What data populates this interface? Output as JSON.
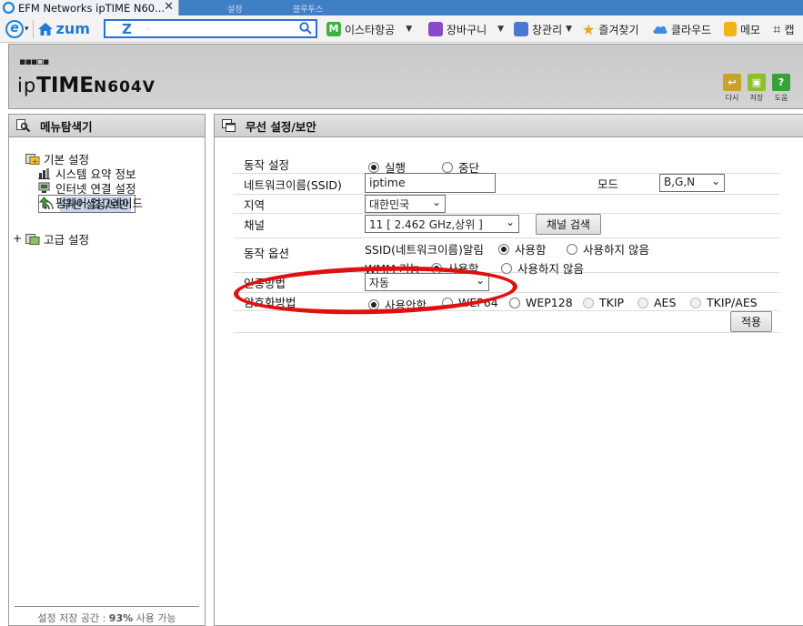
{
  "browser": {
    "tab_title": "EFM Networks ipTIME N60...",
    "tab_close": "✕",
    "ghost_tab_1": "설정",
    "ghost_tab_2": "블루투스",
    "zum_label": "zum",
    "search_brand": "Z",
    "search_placeholder": "-",
    "toolbar_items": [
      {
        "label": "이스타항공",
        "icon": "m-logo-icon",
        "color": "#3cb23c"
      },
      {
        "label": "장바구니",
        "icon": "cart-icon",
        "color": "#8a49c8"
      },
      {
        "label": "창관리",
        "icon": "window-icon",
        "color": "#4a77d0"
      },
      {
        "label": "즐겨찾기",
        "icon": "star-icon",
        "color": "#f0a31a"
      },
      {
        "label": "클라우드",
        "icon": "cloud-icon",
        "color": "#3b8de0"
      },
      {
        "label": "메모",
        "icon": "memo-icon",
        "color": "#f2b21b"
      },
      {
        "label": "캡",
        "icon": "crop-icon",
        "color": "#333333"
      }
    ]
  },
  "router": {
    "brand_prefix": "ip",
    "brand_bold": "TIME",
    "model": "N604V",
    "header_buttons": [
      {
        "label": "다시",
        "icon": "undo-icon",
        "color": "#c8a22a"
      },
      {
        "label": "저장",
        "icon": "save-icon",
        "color": "#8fbf2e"
      },
      {
        "label": "도움",
        "icon": "help-icon",
        "color": "#3aa03a"
      }
    ]
  },
  "nav": {
    "title": "메뉴탐색기",
    "basic_group": "기본 설정",
    "items": [
      "시스템 요약 정보",
      "인터넷 연결 설정",
      "무선 설정/보안",
      "펌웨어 업그레이드"
    ],
    "advanced_group": "고급 설정",
    "expander": "+",
    "footer_prefix": "설정 저장 공간 : ",
    "footer_value": "93%",
    "footer_suffix": " 사용 가능"
  },
  "main": {
    "title": "무선 설정/보안",
    "operation": {
      "label": "동작 설정",
      "option_on": "실행",
      "option_off": "중단",
      "selected": "실행"
    },
    "ssid": {
      "label": "네트워크이름(SSID)",
      "value": "iptime"
    },
    "mode": {
      "label": "모드",
      "value": "B,G,N"
    },
    "region": {
      "label": "지역",
      "value": "대한민국"
    },
    "channel": {
      "label": "채널",
      "value": "11 [ 2.462 GHz,상위 ]",
      "search_button": "채널 검색"
    },
    "options": {
      "label": "동작 옵션",
      "ssid_broadcast_label": "SSID(네트워크이름)알림",
      "wmm_label": "WMM 기능",
      "use": "사용함",
      "not_use": "사용하지 않음"
    },
    "auth": {
      "label": "인증방법",
      "value": "자동"
    },
    "encryption": {
      "label": "암호화방법",
      "options": [
        "사용안함",
        "WEP64",
        "WEP128",
        "TKIP",
        "AES",
        "TKIP/AES"
      ],
      "selected": "사용안함"
    },
    "apply_button": "적용"
  },
  "annotation_color": "#e01010"
}
